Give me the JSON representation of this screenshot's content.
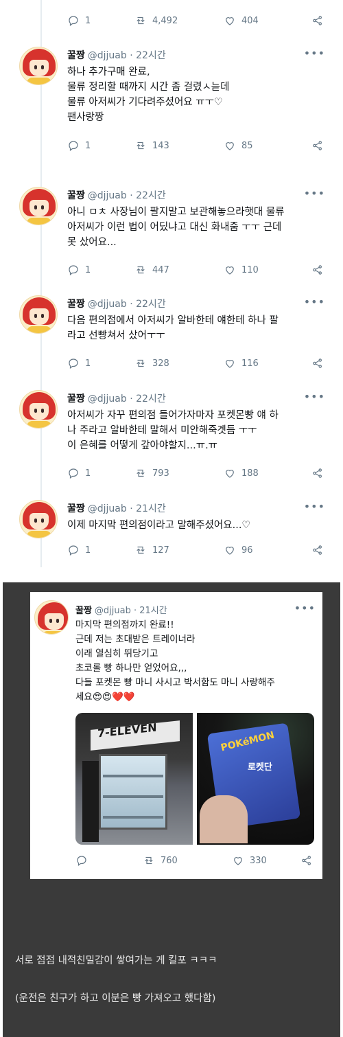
{
  "icons": {
    "reply": "reply-icon",
    "retweet": "retweet-icon",
    "like": "heart-icon",
    "share": "share-icon",
    "more": "more-icon"
  },
  "top_actions": {
    "reply": "1",
    "retweet": "4,492",
    "like": "404"
  },
  "tweets": [
    {
      "name": "꿀짱",
      "handle": "@djjuab · 22시간",
      "lines": [
        "하나 추가구매 완료,",
        "물류 정리할 때까지 시간 좀 걸렸ㅅ늗데",
        "물류 아저씨가 기다려주셨어요 ㅠㅜ♡",
        "팬사랑짱"
      ],
      "reply": "1",
      "retweet": "143",
      "like": "85"
    },
    {
      "name": "꿀짱",
      "handle": "@djjuab · 22시간",
      "lines": [
        "아니 ㅁㅊ 사장님이 팔지말고 보관해놓으라햇대 물류",
        "아저씨가 이런 법이 어딨냐고 대신 화내줌 ㅜㅜ 근데",
        "못 샀어요..."
      ],
      "reply": "1",
      "retweet": "447",
      "like": "110"
    },
    {
      "name": "꿀짱",
      "handle": "@djjuab · 22시간",
      "lines": [
        "다음 편의점에서 아저씨가 알바한테 얘한테 하나 팔",
        "라고 선빵쳐서 샀어ㅜㅜ"
      ],
      "reply": "1",
      "retweet": "328",
      "like": "116"
    },
    {
      "name": "꿀짱",
      "handle": "@djjuab · 22시간",
      "lines": [
        "아저씨가 자꾸 편의점 들어가자마자 포켓몬빵 얘 하",
        "나 주라고 알바한테 말해서 미안해죽겟듬 ㅜㅜ",
        "이 은혜를 어떻게 갚아야할지...ㅠ.ㅠ"
      ],
      "reply": "1",
      "retweet": "793",
      "like": "188"
    },
    {
      "name": "꿀짱",
      "handle": "@djjuab · 21시간",
      "lines": [
        "이제 마지막 편의점이라고 말해주셨어요...♡"
      ],
      "reply": "1",
      "retweet": "127",
      "like": "96"
    }
  ],
  "final_tweet": {
    "name": "꿀짱",
    "handle": "@djjuab · 21시간",
    "lines": [
      "마지막 편의점까지 완료!!",
      "근데 저는 초대받은 트레이너라",
      "이래 열심히 뛰당기고",
      "초코롤 빵 하나만 얻었어요,,,",
      "다들 포켓몬 빵 마니 사시고 박서함도 마니 사랑해주",
      "세요😍😍❤️❤️"
    ],
    "photo_store_sign": "7-ELEVEN",
    "photo_bag_logo": "POKéMON",
    "photo_bag_text": "로켓단",
    "retweet": "760",
    "like": "330"
  },
  "captions": [
    "서로 점점 내적친밀감이 쌓여가는 게 킬포 ㅋㅋㅋ",
    "(운전은 친구가 하고 이분은 빵 가져오고 했다함)"
  ]
}
